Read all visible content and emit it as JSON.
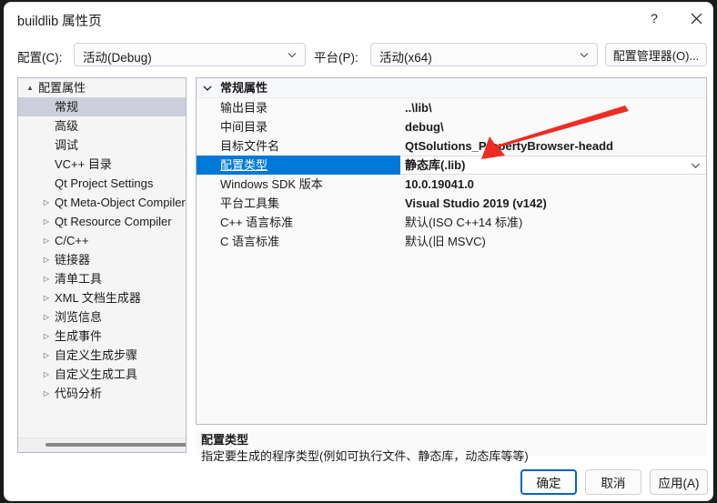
{
  "window": {
    "title": "buildlib 属性页",
    "help_icon": "question-mark-icon",
    "close_icon": "close-icon"
  },
  "config_bar": {
    "config_label": "配置(C):",
    "config_value": "活动(Debug)",
    "platform_label": "平台(P):",
    "platform_value": "活动(x64)",
    "config_manager_label": "配置管理器(O)...",
    "chevron_icon": "chevron-down-icon"
  },
  "tree": {
    "items": [
      {
        "label": "配置属性",
        "level": 0,
        "glyph": "▲",
        "expanded": true,
        "selected": false
      },
      {
        "label": "常规",
        "level": 1,
        "glyph": "",
        "expanded": false,
        "selected": true
      },
      {
        "label": "高级",
        "level": 1,
        "glyph": "",
        "expanded": false,
        "selected": false
      },
      {
        "label": "调试",
        "level": 1,
        "glyph": "",
        "expanded": false,
        "selected": false
      },
      {
        "label": "VC++ 目录",
        "level": 1,
        "glyph": "",
        "expanded": false,
        "selected": false
      },
      {
        "label": "Qt Project Settings",
        "level": 1,
        "glyph": "",
        "expanded": false,
        "selected": false
      },
      {
        "label": "Qt Meta-Object Compiler",
        "level": 1,
        "glyph": "▷",
        "expanded": false,
        "selected": false
      },
      {
        "label": "Qt Resource Compiler",
        "level": 1,
        "glyph": "▷",
        "expanded": false,
        "selected": false
      },
      {
        "label": "C/C++",
        "level": 1,
        "glyph": "▷",
        "expanded": false,
        "selected": false
      },
      {
        "label": "链接器",
        "level": 1,
        "glyph": "▷",
        "expanded": false,
        "selected": false
      },
      {
        "label": "清单工具",
        "level": 1,
        "glyph": "▷",
        "expanded": false,
        "selected": false
      },
      {
        "label": "XML 文档生成器",
        "level": 1,
        "glyph": "▷",
        "expanded": false,
        "selected": false
      },
      {
        "label": "浏览信息",
        "level": 1,
        "glyph": "▷",
        "expanded": false,
        "selected": false
      },
      {
        "label": "生成事件",
        "level": 1,
        "glyph": "▷",
        "expanded": false,
        "selected": false
      },
      {
        "label": "自定义生成步骤",
        "level": 1,
        "glyph": "▷",
        "expanded": false,
        "selected": false
      },
      {
        "label": "自定义生成工具",
        "level": 1,
        "glyph": "▷",
        "expanded": false,
        "selected": false
      },
      {
        "label": "代码分析",
        "level": 1,
        "glyph": "▷",
        "expanded": false,
        "selected": false
      }
    ],
    "scrollbar_icon": "horizontal-scrollbar"
  },
  "grid": {
    "header": "常规属性",
    "header_chevron_icon": "chevron-down-icon",
    "rows": [
      {
        "name": "输出目录",
        "value": "..\\lib\\",
        "bold": true,
        "selected": false
      },
      {
        "name": "中间目录",
        "value": "debug\\",
        "bold": true,
        "selected": false
      },
      {
        "name": "目标文件名",
        "value": "QtSolutions_PropertyBrowser-headd",
        "bold": true,
        "selected": false
      },
      {
        "name": "配置类型",
        "value": "静态库(.lib)",
        "bold": true,
        "selected": true
      },
      {
        "name": "Windows SDK 版本",
        "value": "10.0.19041.0",
        "bold": true,
        "selected": false
      },
      {
        "name": "平台工具集",
        "value": "Visual Studio 2019 (v142)",
        "bold": true,
        "selected": false
      },
      {
        "name": "C++ 语言标准",
        "value": "默认(ISO C++14 标准)",
        "bold": false,
        "selected": false
      },
      {
        "name": "C 语言标准",
        "value": "默认(旧 MSVC)",
        "bold": false,
        "selected": false
      }
    ],
    "editor_chevron_icon": "chevron-down-icon"
  },
  "description": {
    "title": "配置类型",
    "body": "指定要生成的程序类型(例如可执行文件、静态库，动态库等等)"
  },
  "footer": {
    "ok_label": "确定",
    "cancel_label": "取消",
    "apply_label": "应用(A)"
  },
  "annotation": {
    "arrow_icon": "red-arrow-annotation",
    "color": "#ee2c24"
  },
  "colors": {
    "selection_blue": "#0078d7",
    "focus_blue": "#0067c0",
    "tree_selection": "#cdcedc",
    "annotation_red": "#ee2c24"
  }
}
